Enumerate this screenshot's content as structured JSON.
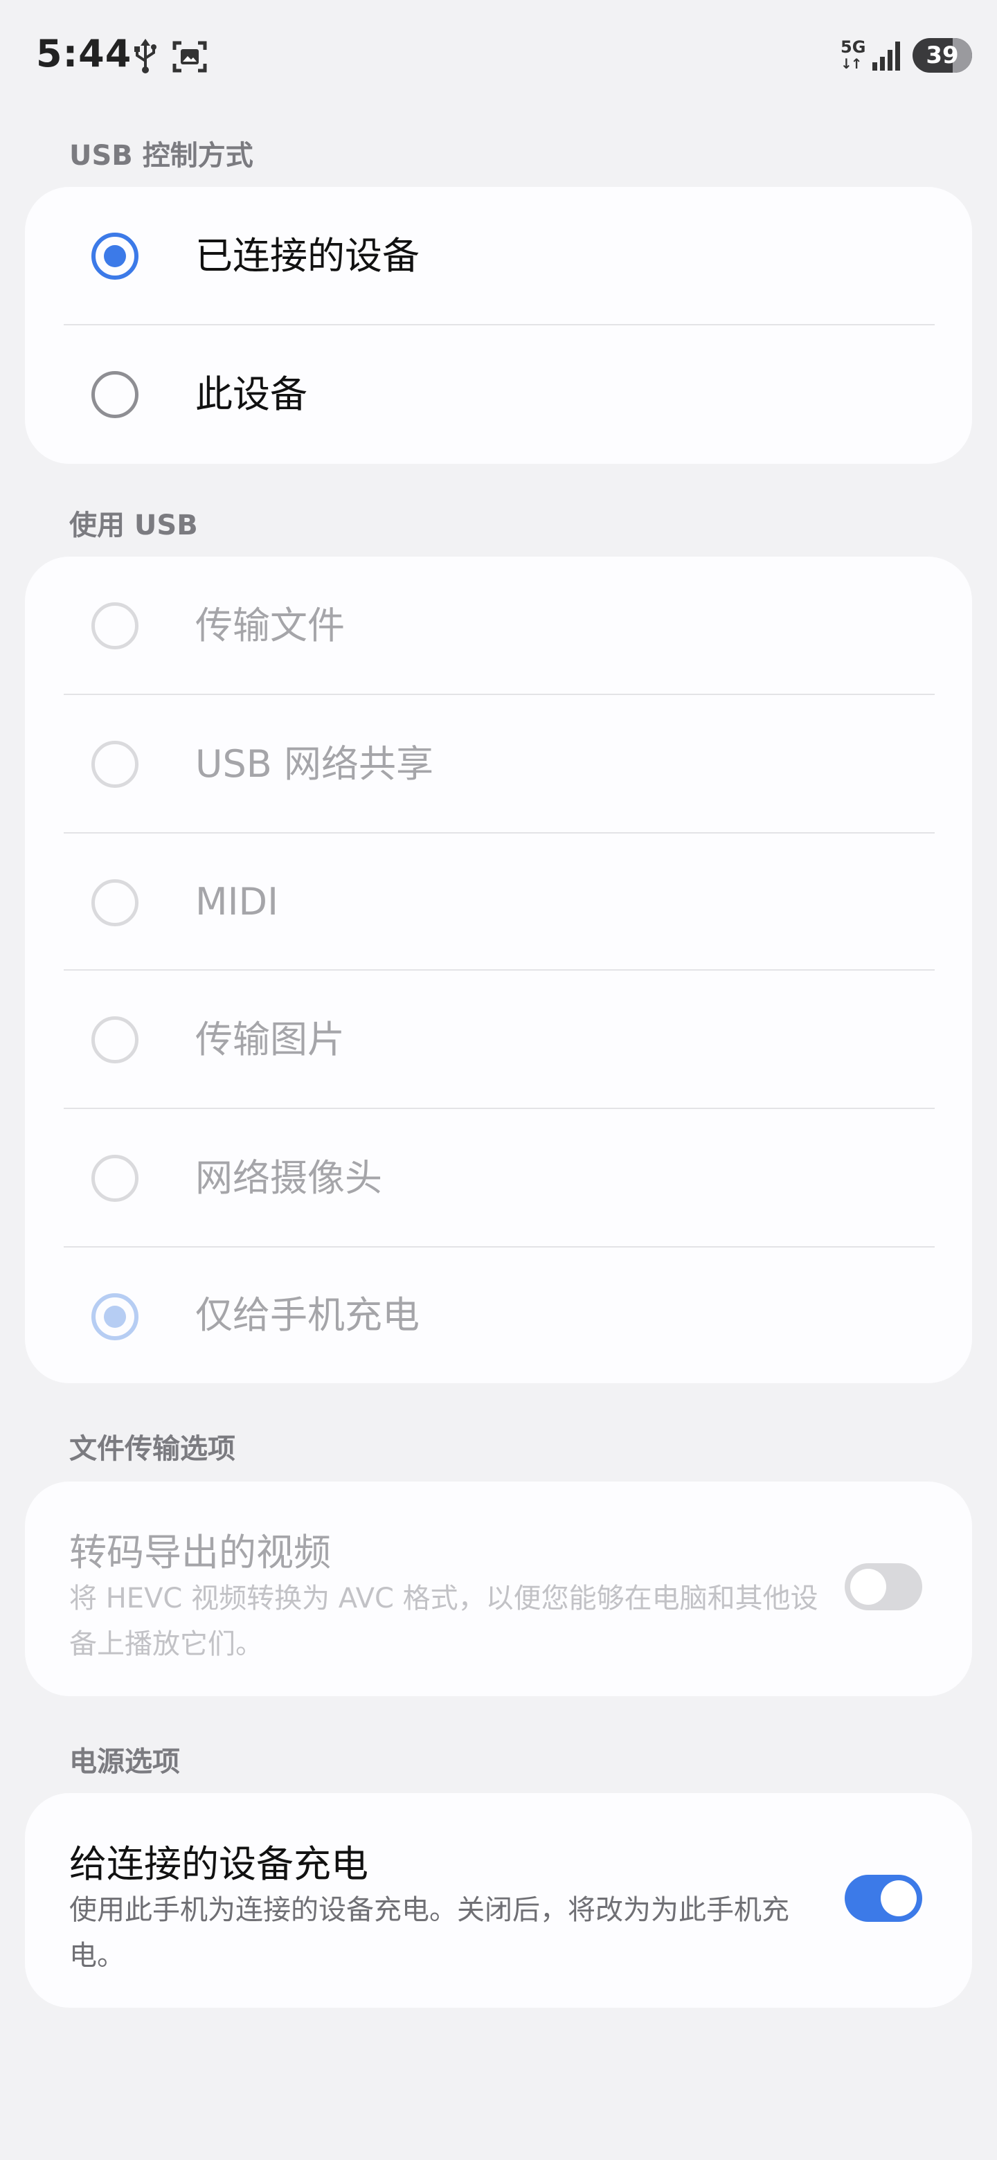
{
  "status_bar": {
    "time": "5:44",
    "network": "5G",
    "battery": "39",
    "icons": [
      "usb-icon",
      "screenshot-icon",
      "signal-icon",
      "battery-icon"
    ]
  },
  "usb_control": {
    "header": "USB 控制方式",
    "options": [
      {
        "label": "已连接的设备",
        "selected": true
      },
      {
        "label": "此设备",
        "selected": false
      }
    ]
  },
  "use_usb": {
    "header": "使用 USB",
    "options": [
      {
        "label": "传输文件",
        "selected": false,
        "enabled": false
      },
      {
        "label": "USB 网络共享",
        "selected": false,
        "enabled": false
      },
      {
        "label": "MIDI",
        "selected": false,
        "enabled": false
      },
      {
        "label": "传输图片",
        "selected": false,
        "enabled": false
      },
      {
        "label": "网络摄像头",
        "selected": false,
        "enabled": false
      },
      {
        "label": "仅给手机充电",
        "selected": true,
        "enabled": false
      }
    ]
  },
  "file_transfer": {
    "header": "文件传输选项",
    "title": "转码导出的视频",
    "description": "将 HEVC 视频转换为 AVC 格式，以便您能够在电脑和其他设备上播放它们。",
    "toggle_on": false,
    "enabled": false
  },
  "power": {
    "header": "电源选项",
    "title": "给连接的设备充电",
    "description": "使用此手机为连接的设备充电。关闭后，将改为为此手机充电。",
    "toggle_on": true
  },
  "colors": {
    "accent": "#3c7ae8",
    "background": "#f2f2f4",
    "card": "#fdfdff",
    "dim_text": "#a5a5a9",
    "header_text": "#7b7b80"
  }
}
